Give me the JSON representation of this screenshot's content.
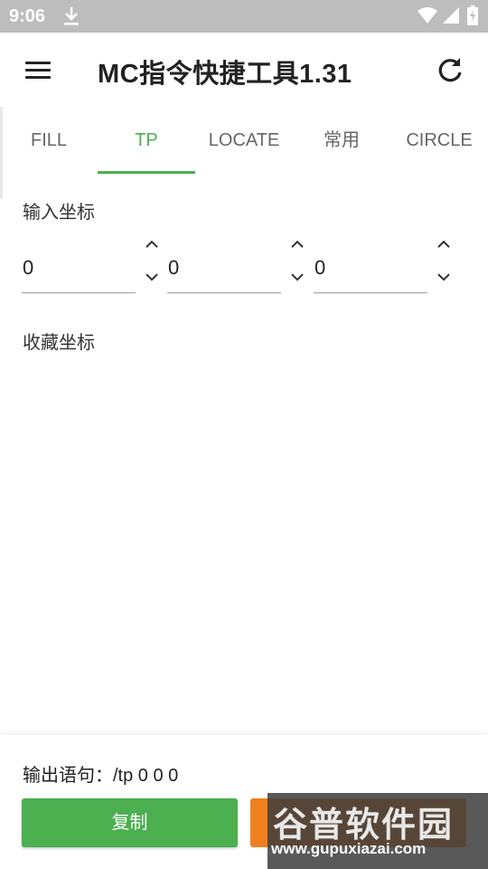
{
  "status_bar": {
    "time": "9:06",
    "icons": [
      "download-icon",
      "wifi-icon",
      "signal-icon",
      "battery-icon"
    ]
  },
  "app_bar": {
    "title": "MC指令快捷工具1.31",
    "left_icon": "menu-icon",
    "right_icon": "refresh-icon"
  },
  "tabs": [
    {
      "label": "FILL",
      "active": false
    },
    {
      "label": "TP",
      "active": true
    },
    {
      "label": "LOCATE",
      "active": false
    },
    {
      "label": "常用",
      "active": false
    },
    {
      "label": "CIRCLE",
      "active": false
    }
  ],
  "input_section": {
    "label": "输入坐标",
    "coords": [
      {
        "value": "0"
      },
      {
        "value": "0"
      },
      {
        "value": "0"
      }
    ]
  },
  "favorites_section": {
    "label": "收藏坐标"
  },
  "output": {
    "text": "输出语句：/tp 0 0 0"
  },
  "buttons": {
    "copy_label": "复制"
  },
  "watermark": {
    "title": "谷普软件园",
    "url": "www.gupuxiazai.com"
  },
  "colors": {
    "accent": "#4caf50",
    "secondary_button": "#f0801e",
    "status_bar": "#bdbdbd"
  }
}
